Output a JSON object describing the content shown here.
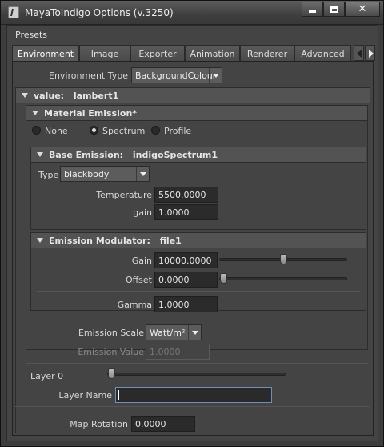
{
  "window": {
    "title": "MayaToIndigo Options (v.3250)"
  },
  "menu": {
    "presets": "Presets"
  },
  "tabs": [
    {
      "label": "Environment",
      "active": true
    },
    {
      "label": "Image"
    },
    {
      "label": "Exporter"
    },
    {
      "label": "Animation"
    },
    {
      "label": "Renderer"
    },
    {
      "label": "Advanced"
    }
  ],
  "environment_type": {
    "label": "Environment Type",
    "value": "BackgroundColour"
  },
  "value_section": {
    "label": "value:",
    "name": "lambert1"
  },
  "material_emission": {
    "title": "Material Emission*",
    "radios": [
      {
        "label": "None",
        "selected": false
      },
      {
        "label": "Spectrum",
        "selected": true
      },
      {
        "label": "Profile",
        "selected": false
      }
    ]
  },
  "base_emission": {
    "title": "Base Emission:",
    "name": "indigoSpectrum1",
    "type_label": "Type",
    "type_value": "blackbody",
    "temperature_label": "Temperature",
    "temperature_value": "5500.0000",
    "gain_label": "gain",
    "gain_value": "1.0000"
  },
  "emission_modulator": {
    "title": "Emission Modulator:",
    "name": "file1",
    "gain_label": "Gain",
    "gain_value": "10000.0000",
    "gain_slider": 0.5,
    "offset_label": "Offset",
    "offset_value": "0.0000",
    "offset_slider": 0.0,
    "gamma_label": "Gamma",
    "gamma_value": "1.0000"
  },
  "emission_scale": {
    "label": "Emission Scale",
    "value": "Watt/m²"
  },
  "emission_value": {
    "label": "Emission Value",
    "value": "1.0000"
  },
  "layer": {
    "label": "Layer 0",
    "slider": 0.0,
    "name_label": "Layer Name",
    "name_value": ""
  },
  "map_rotation": {
    "label": "Map Rotation",
    "value": "0.0000"
  }
}
